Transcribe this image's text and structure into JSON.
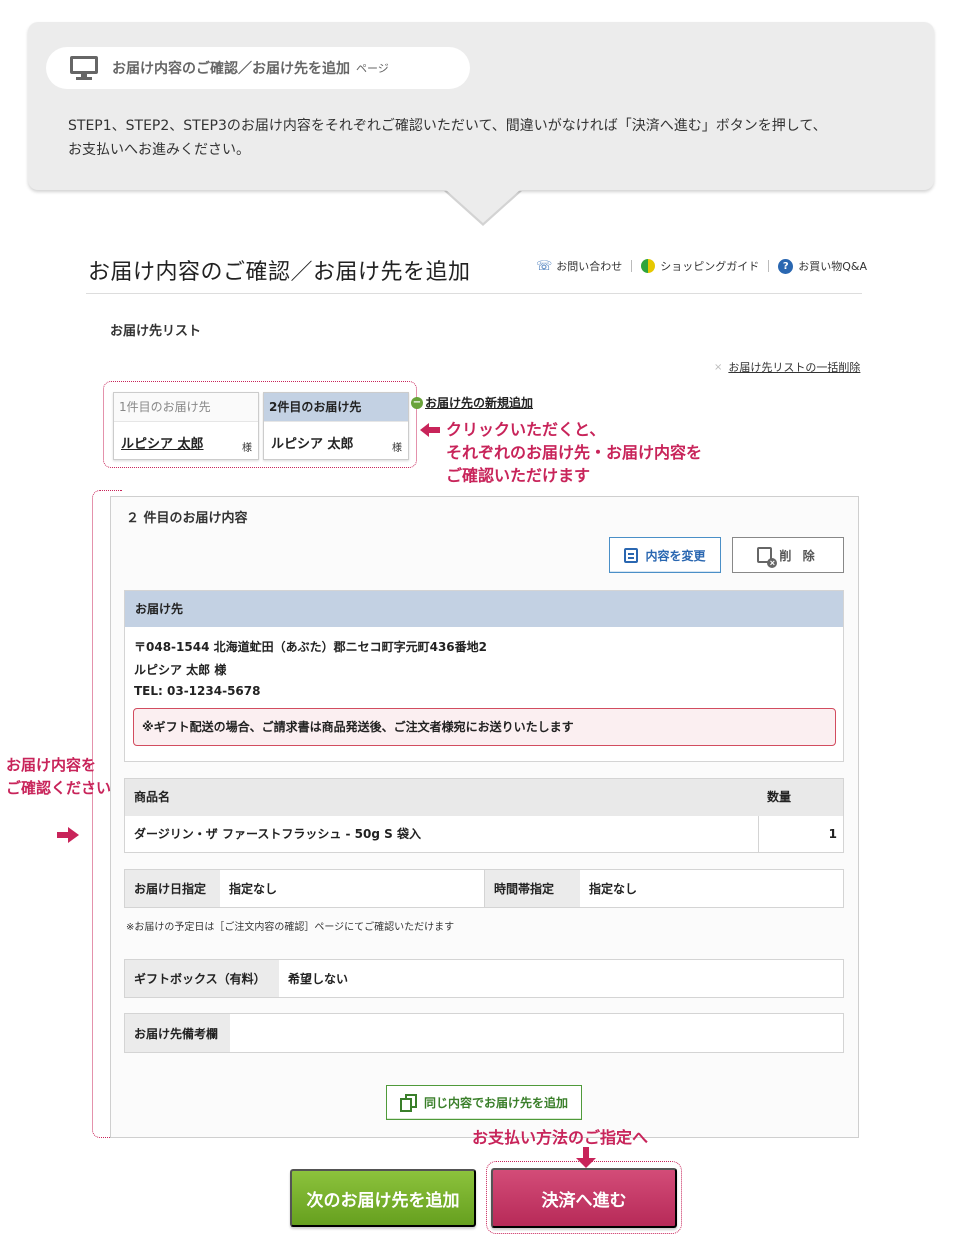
{
  "intro": {
    "title": "お届け内容のご確認／お届け先を追加",
    "title_suffix": "ページ",
    "description_line1": "STEP1、STEP2、STEP3のお届け内容をそれぞれご確認いただいて、間違いがなければ「決済へ進む」ボタンを押して、",
    "description_line2": "お支払いへお進みください。",
    "icon": "monitor-icon"
  },
  "header": {
    "page_title": "お届け内容のご確認／お届け先を追加",
    "links": [
      {
        "label": "お問い合わせ",
        "icon": "phone-icon"
      },
      {
        "label": "ショッピングガイド",
        "icon": "leaf-icon"
      },
      {
        "label": "お買い物Q&A",
        "icon": "question-icon"
      }
    ]
  },
  "recipients": {
    "section_label": "お届け先リスト",
    "bulk_delete": "お届け先リストの一括削除",
    "add_new": "お届け先の新規追加",
    "tabs": [
      {
        "head": "1件目のお届け先",
        "name": "ルピシア 太郎",
        "honorific": "様",
        "active": false
      },
      {
        "head": "2件目のお届け先",
        "name": "ルピシア 太郎",
        "honorific": "様",
        "active": true
      }
    ]
  },
  "annotations": {
    "click_line1": "クリックいただくと、",
    "click_line2": "それぞれのお届け先・お届け内容を",
    "click_line3": "ご確認いただけます",
    "confirm_line1": "お届け内容を",
    "confirm_line2": "ご確認ください",
    "payment": "お支払い方法のご指定へ"
  },
  "detail": {
    "title": "２ 件目のお届け内容",
    "edit_button": "内容を変更",
    "delete_button": "削 除",
    "address": {
      "heading": "お届け先",
      "postal_line": "〒048-1544 北海道虻田（あぶた）郡ニセコ町字元町436番地2",
      "name_line": "ルピシア 太郎 様",
      "tel_line": "TEL: 03-1234-5678",
      "notice": "※ギフト配送の場合、ご請求書は商品発送後、ご注文者様宛にお送りいたします"
    },
    "items": {
      "headers": [
        "商品名",
        "数量"
      ],
      "rows": [
        {
          "name": "ダージリン・ザ ファーストフラッシュ - 50g S 袋入",
          "qty": "1"
        }
      ]
    },
    "delivery": {
      "date_label": "お届け日指定",
      "date_value": "指定なし",
      "time_label": "時間帯指定",
      "time_value": "指定なし",
      "note": "※お届けの予定日は［ご注文内容の確認］ページにてご確認いただけます"
    },
    "gift": {
      "label": "ギフトボックス（有料）",
      "value": "希望しない"
    },
    "remarks": {
      "label": "お届け先備考欄",
      "value": ""
    },
    "add_same_button": "同じ内容でお届け先を追加"
  },
  "actions": {
    "next_recipient": "次のお届け先を追加",
    "proceed_payment": "決済へ進む"
  },
  "colors": {
    "accent": "#c8245a",
    "green": "#6aa02a",
    "tab_active": "#c3d1e3"
  }
}
